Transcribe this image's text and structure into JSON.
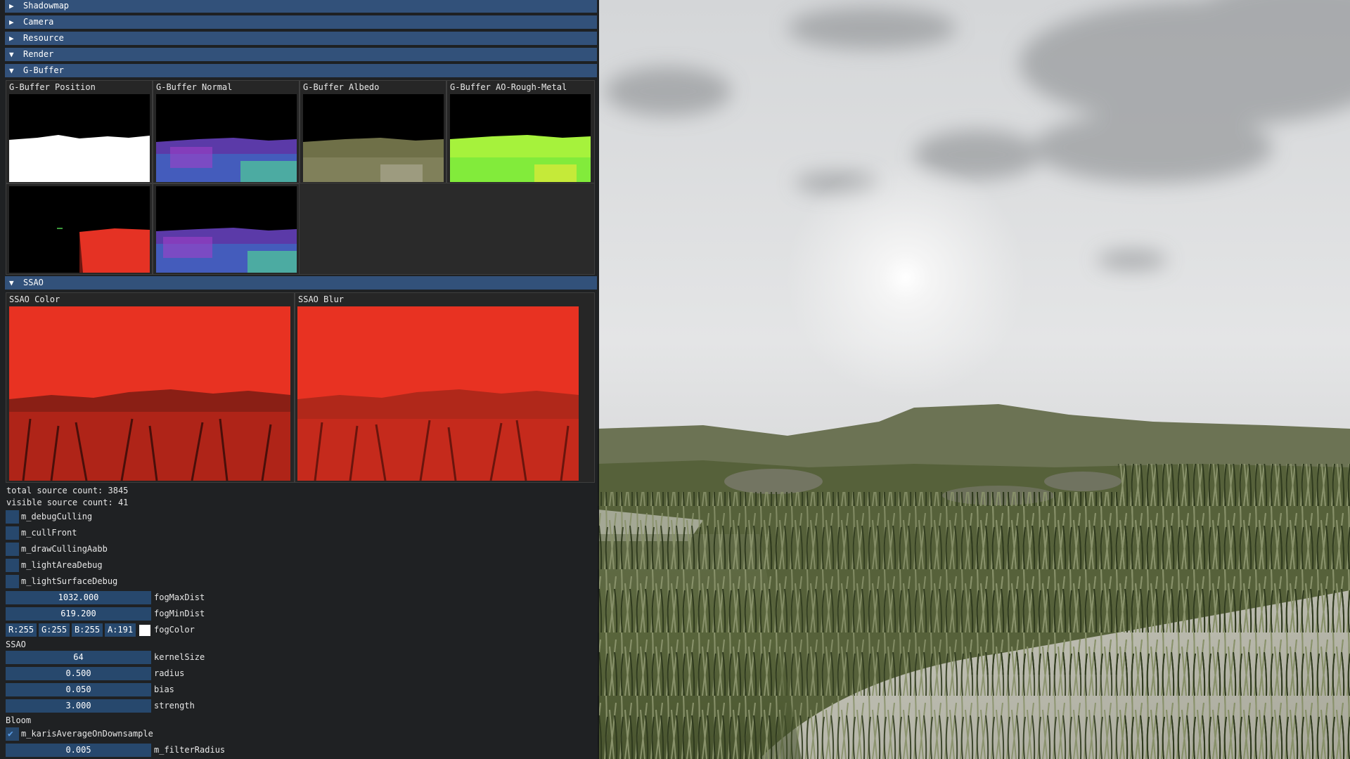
{
  "panel": {
    "sections": [
      {
        "label": "Shadowmap",
        "expanded": false
      },
      {
        "label": "Camera",
        "expanded": false
      },
      {
        "label": "Resource",
        "expanded": false
      },
      {
        "label": "Render",
        "expanded": true
      },
      {
        "label": "G-Buffer",
        "expanded": true
      }
    ],
    "arrows": {
      "collapsed": "▶",
      "expanded": "▼"
    },
    "gbuffer": {
      "titles": [
        "G-Buffer Position",
        "G-Buffer Normal",
        "G-Buffer Albedo",
        "G-Buffer AO-Rough-Metal"
      ]
    },
    "ssao_section": {
      "label": "SSAO",
      "expanded": true
    },
    "ssao_images": {
      "color_title": "SSAO Color",
      "blur_title": "SSAO Blur"
    },
    "stats": {
      "total": "total source count: 3845",
      "visible": "visible source count: 41"
    },
    "checkboxes": [
      {
        "label": "m_debugCulling",
        "checked": false
      },
      {
        "label": "m_cullFront",
        "checked": false
      },
      {
        "label": "m_drawCullingAabb",
        "checked": false
      },
      {
        "label": "m_lightAreaDebug",
        "checked": false
      },
      {
        "label": "m_lightSurfaceDebug",
        "checked": false
      }
    ],
    "fog": {
      "max": {
        "value": "1032.000",
        "label": "fogMaxDist"
      },
      "min": {
        "value": "619.200",
        "label": "fogMinDist"
      },
      "color": {
        "r": "R:255",
        "g": "G:255",
        "b": "B:255",
        "a": "A:191",
        "label": "fogColor",
        "swatch": "#ffffff"
      }
    },
    "ssao_params": {
      "heading": "SSAO",
      "kernel": {
        "value": "64",
        "label": "kernelSize"
      },
      "radius": {
        "value": "0.500",
        "label": "radius"
      },
      "bias": {
        "value": "0.050",
        "label": "bias"
      },
      "strength": {
        "value": "3.000",
        "label": "strength"
      }
    },
    "bloom": {
      "heading": "Bloom",
      "karis": {
        "label": "m_karisAverageOnDownsample",
        "checked": true
      },
      "filter": {
        "value": "0.005",
        "label": "m_filterRadius"
      }
    }
  },
  "colors": {
    "header": "#32517a",
    "widget": "#27486d",
    "ssao_red": "#e83222"
  }
}
